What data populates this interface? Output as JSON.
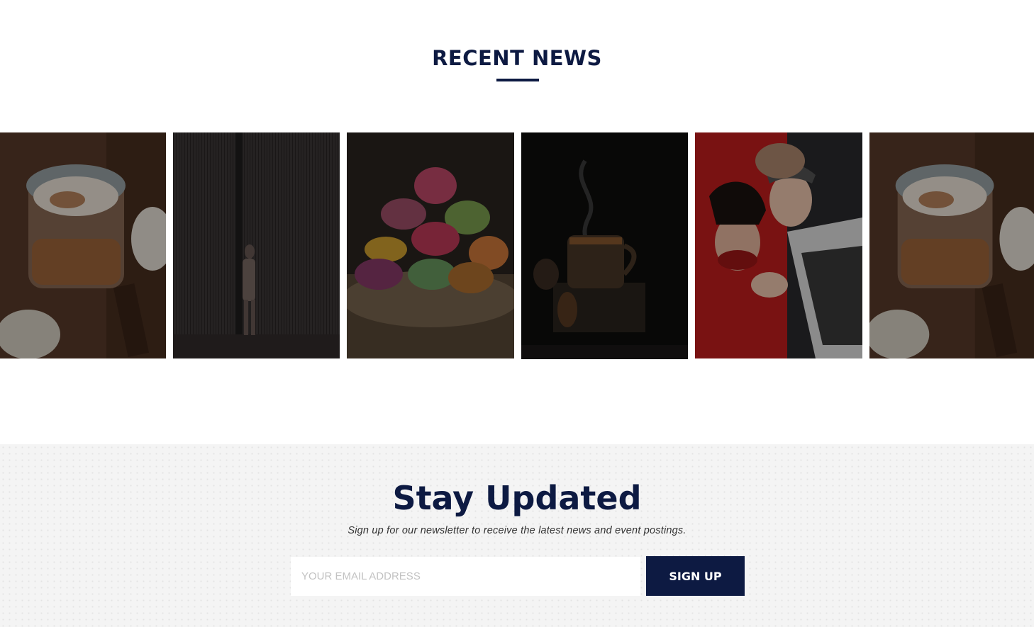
{
  "colors": {
    "navy": "#0d1a42",
    "newsletter_bg": "#f4f4f4"
  },
  "recent_news": {
    "title": "RECENT NEWS",
    "cards": [
      {
        "image": "jar-dessert-photo"
      },
      {
        "image": "string-curtain-woman-photo"
      },
      {
        "image": "macarons-photo"
      },
      {
        "image": "steaming-tea-cup-photo"
      },
      {
        "image": "two-women-red-dress-photo"
      },
      {
        "image": "jar-dessert-photo"
      }
    ]
  },
  "newsletter": {
    "title": "Stay Updated",
    "subtitle": "Sign up for our newsletter to receive the latest news and event postings.",
    "email_placeholder": "YOUR EMAIL ADDRESS",
    "button_label": "SIGN UP"
  }
}
